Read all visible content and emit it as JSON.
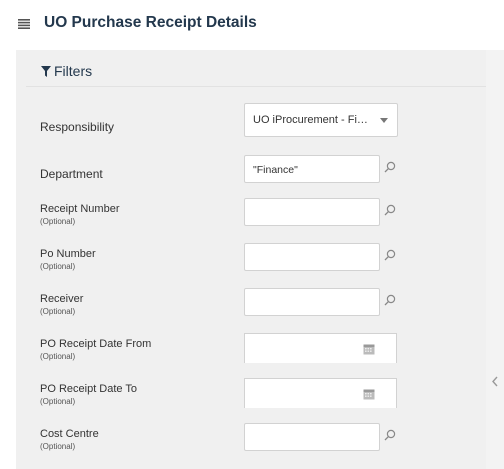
{
  "page": {
    "title": "UO Purchase Receipt Details"
  },
  "filters": {
    "header_label": "Filters",
    "fields": [
      {
        "label": "Responsibility",
        "value": "UO iProcurement - Finance"
      },
      {
        "label": "Department",
        "value": "\"Finance\""
      },
      {
        "label": "Receipt Number",
        "optional": "(Optional)",
        "value": ""
      },
      {
        "label": "Po Number",
        "optional": "(Optional)",
        "value": ""
      },
      {
        "label": "Receiver",
        "optional": "(Optional)",
        "value": ""
      },
      {
        "label": "PO Receipt Date From",
        "optional": "(Optional)",
        "value": ""
      },
      {
        "label": "PO Receipt Date To",
        "optional": "(Optional)",
        "value": ""
      },
      {
        "label": "Cost Centre",
        "optional": "(Optional)",
        "value": ""
      }
    ]
  },
  "icons": {
    "menu": "menu-icon",
    "filter": "filter-icon",
    "search": "search-icon",
    "calendar": "calendar-icon",
    "caret": "chevron-down-icon",
    "collapse": "chevron-left-icon"
  },
  "colors": {
    "title": "#23384d",
    "panel_bg": "#f0f0f0",
    "input_border": "#d2d2d2"
  }
}
